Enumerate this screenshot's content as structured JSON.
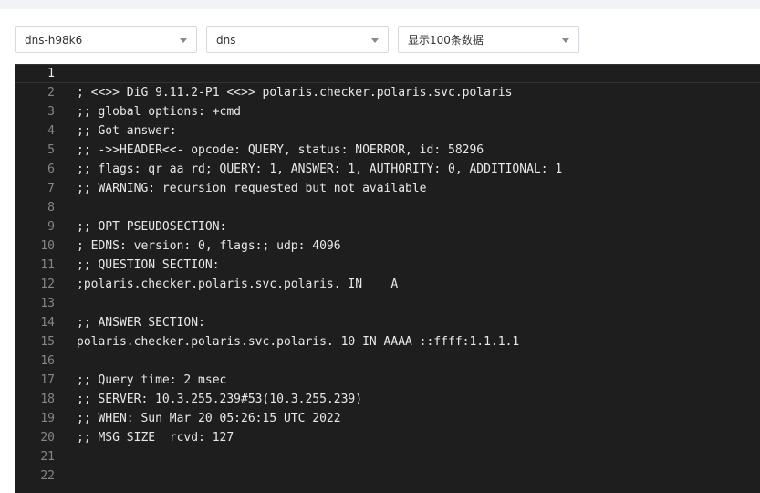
{
  "filters": {
    "pod": "dns-h98k6",
    "container": "dns",
    "lines": "显示100条数据"
  },
  "editor": {
    "lines": [
      {
        "num": "1",
        "text": ""
      },
      {
        "num": "2",
        "text": "; <<>> DiG 9.11.2-P1 <<>> polaris.checker.polaris.svc.polaris"
      },
      {
        "num": "3",
        "text": ";; global options: +cmd"
      },
      {
        "num": "4",
        "text": ";; Got answer:"
      },
      {
        "num": "5",
        "text": ";; ->>HEADER<<- opcode: QUERY, status: NOERROR, id: 58296"
      },
      {
        "num": "6",
        "text": ";; flags: qr aa rd; QUERY: 1, ANSWER: 1, AUTHORITY: 0, ADDITIONAL: 1"
      },
      {
        "num": "7",
        "text": ";; WARNING: recursion requested but not available"
      },
      {
        "num": "8",
        "text": ""
      },
      {
        "num": "9",
        "text": ";; OPT PSEUDOSECTION:"
      },
      {
        "num": "10",
        "text": "; EDNS: version: 0, flags:; udp: 4096"
      },
      {
        "num": "11",
        "text": ";; QUESTION SECTION:"
      },
      {
        "num": "12",
        "text": ";polaris.checker.polaris.svc.polaris. IN    A"
      },
      {
        "num": "13",
        "text": ""
      },
      {
        "num": "14",
        "text": ";; ANSWER SECTION:"
      },
      {
        "num": "15",
        "text": "polaris.checker.polaris.svc.polaris. 10 IN AAAA ::ffff:1.1.1.1"
      },
      {
        "num": "16",
        "text": ""
      },
      {
        "num": "17",
        "text": ";; Query time: 2 msec"
      },
      {
        "num": "18",
        "text": ";; SERVER: 10.3.255.239#53(10.3.255.239)"
      },
      {
        "num": "19",
        "text": ";; WHEN: Sun Mar 20 05:26:15 UTC 2022"
      },
      {
        "num": "20",
        "text": ";; MSG SIZE  rcvd: 127"
      },
      {
        "num": "21",
        "text": ""
      },
      {
        "num": "22",
        "text": ""
      }
    ]
  }
}
